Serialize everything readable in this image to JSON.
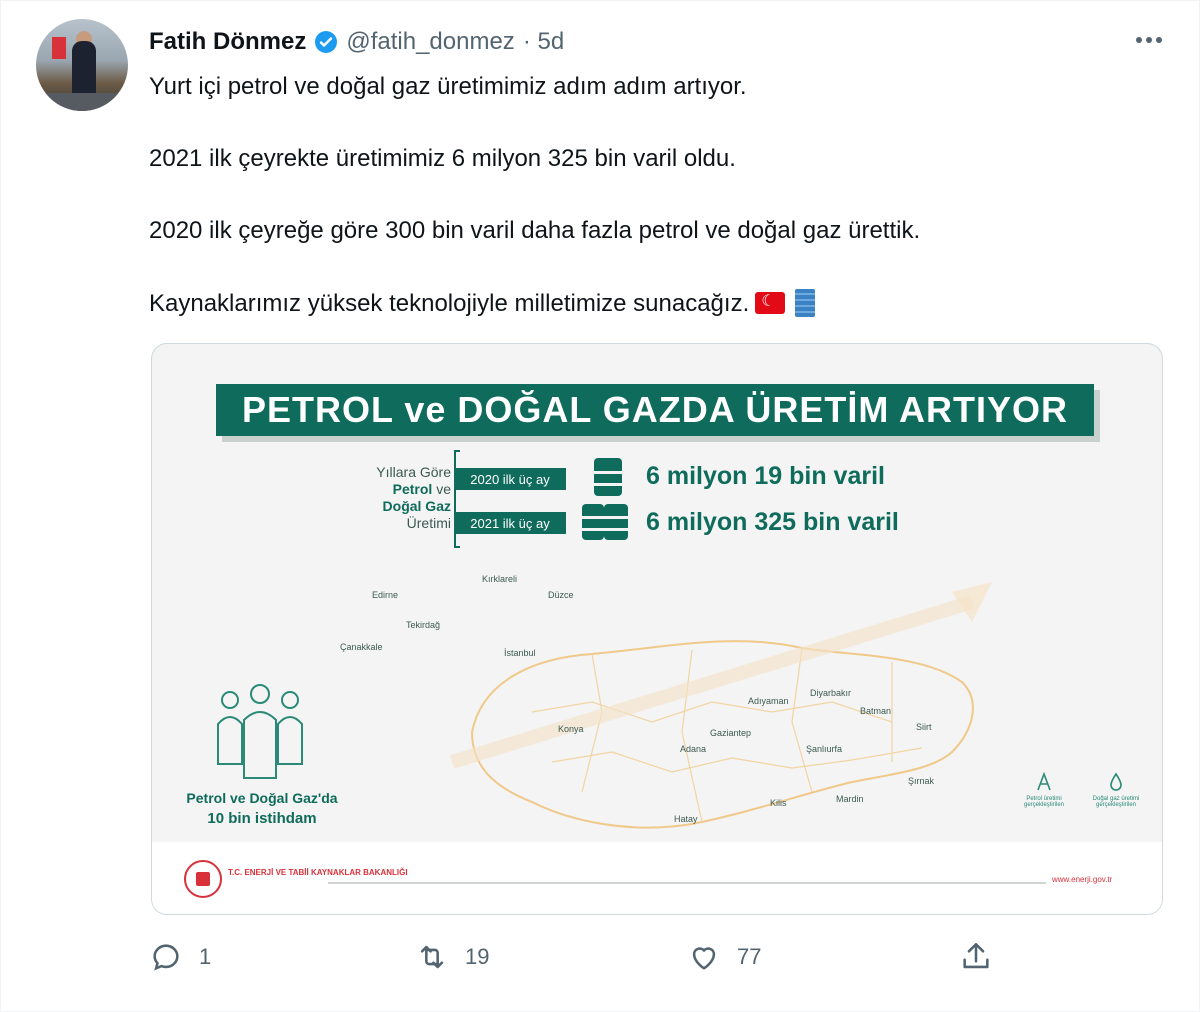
{
  "tweet": {
    "author_name": "Fatih Dönmez",
    "handle": "@fatih_donmez",
    "time": "· 5d",
    "lines": [
      "Yurt içi petrol ve doğal gaz üretimimiz adım adım artıyor.",
      "2021 ilk çeyrekte üretimimiz 6 milyon 325 bin varil oldu.",
      "2020 ilk çeyreğe göre 300 bin varil daha fazla petrol ve doğal gaz ürettik.",
      "Kaynaklarımız yüksek teknolojiyle milletimize sunacağız."
    ],
    "emoji_icons": [
      "turkey-flag-icon",
      "oil-barrel-icon"
    ]
  },
  "media": {
    "banner_title": "PETROL ve DOĞAL GAZDA ÜRETİM ARTIYOR",
    "side_label": {
      "line1": "Yıllara Göre",
      "line2": "Petrol",
      "line2b": "ve",
      "line3": "Doğal Gaz",
      "line4": "Üretimi"
    },
    "rows": [
      {
        "period": "2020 ilk üç ay",
        "amount": "6 milyon 19 bin varil"
      },
      {
        "period": "2021 ilk üç ay",
        "amount": "6 milyon 325 bin varil"
      }
    ],
    "cities": [
      "Edirne",
      "Kırklareli",
      "Düzce",
      "Tekirdağ",
      "Çanakkale",
      "İstanbul",
      "Konya",
      "Adıyaman",
      "Diyarbakır",
      "Batman",
      "Siirt",
      "Gaziantep",
      "Adana",
      "Şanlıurfa",
      "Şırnak",
      "Mardin",
      "Kilis",
      "Hatay"
    ],
    "employment_line1": "Petrol ve Doğal Gaz'da",
    "employment_line2": "10 bin istihdam",
    "legend": [
      "Petrol üretimi gerçekleştirilen",
      "Doğal gaz üretimi gerçekleştirilen"
    ],
    "org": "T.C. ENERJİ VE TABİİ KAYNAKLAR BAKANLIĞI",
    "site": "www.enerji.gov.tr"
  },
  "actions": {
    "reply_count": "1",
    "retweet_count": "19",
    "like_count": "77"
  },
  "colors": {
    "accent_green": "#0f6b5b",
    "verified_blue": "#1d9bf0",
    "text_secondary": "#536471"
  }
}
